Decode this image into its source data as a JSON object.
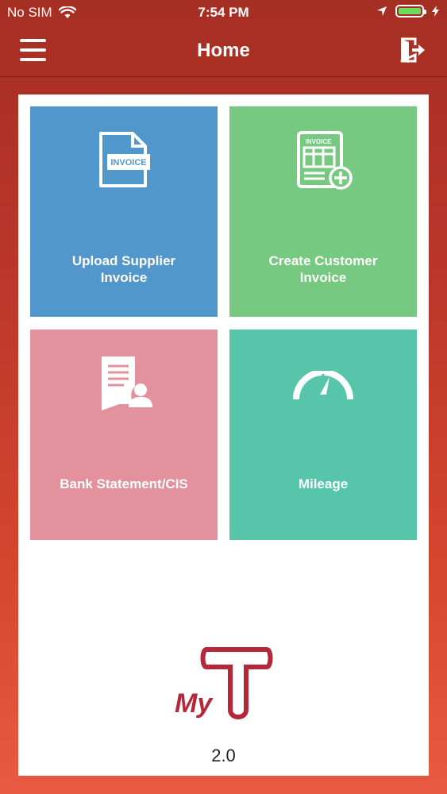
{
  "status_bar": {
    "carrier": "No SIM",
    "time": "7:54 PM"
  },
  "navbar": {
    "title": "Home"
  },
  "tiles": [
    {
      "line1": "Upload Supplier",
      "line2": "Invoice",
      "icon_text": "INVOICE",
      "color": "#5297cb"
    },
    {
      "line1": "Create Customer",
      "line2": "Invoice",
      "icon_text": "INVOICE",
      "color": "#77c981"
    },
    {
      "line1": "Bank Statement/CIS",
      "color": "#e3919c"
    },
    {
      "line1": "Mileage",
      "color": "#56c5aa"
    }
  ],
  "logo": {
    "text": "My",
    "color": "#b5283a"
  },
  "version": "2.0"
}
